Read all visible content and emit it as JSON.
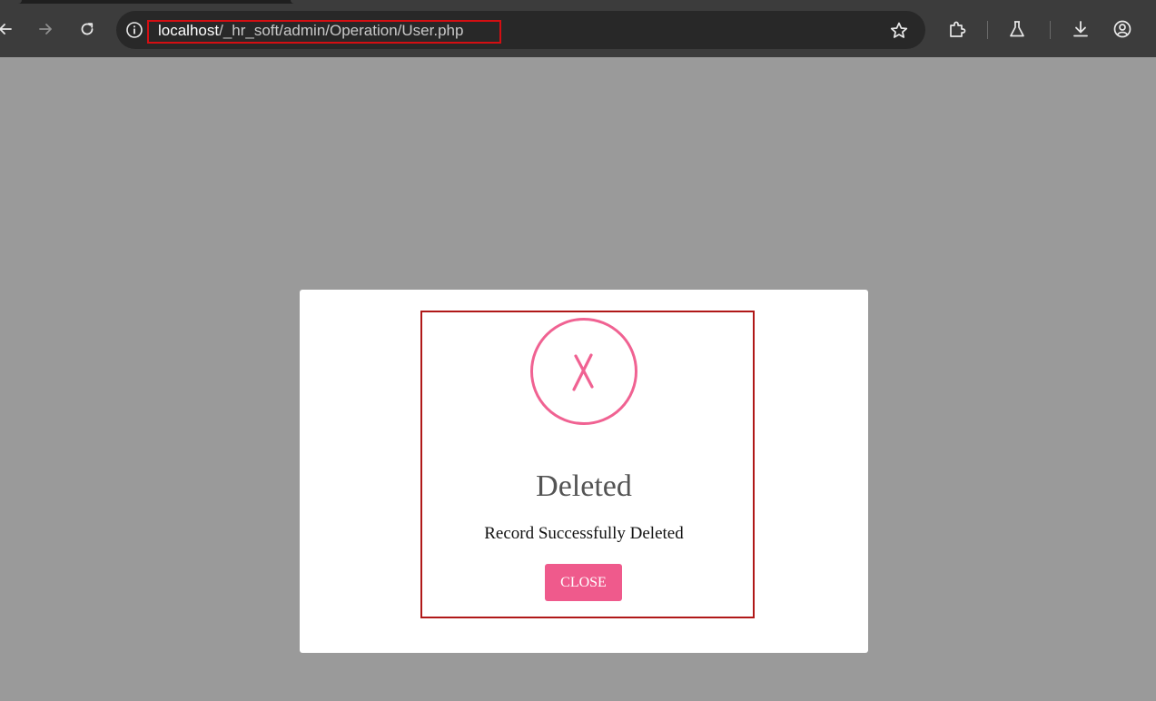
{
  "browser": {
    "url_host": "localhost",
    "url_path": "/_hr_soft/admin/Operation/User.php",
    "icons": {
      "back": "arrow-left-icon",
      "forward": "arrow-right-icon",
      "reload": "reload-icon",
      "site_info": "info-icon",
      "bookmark": "star-icon",
      "extensions": "puzzle-icon",
      "labs": "flask-icon",
      "downloads": "download-icon",
      "profile": "profile-icon"
    },
    "colors": {
      "toolbar": "#3c3c3c",
      "omnibox": "#282828",
      "url_highlight": "#d40e12"
    }
  },
  "modal": {
    "icon": "error-x-icon",
    "title": "Deleted",
    "message": "Record Successfully Deleted",
    "close_label": "CLOSE",
    "colors": {
      "accent": "#f06292",
      "button": "#ef5a8c",
      "overlay": "#9a9a9a",
      "highlight_border": "#b01818"
    }
  }
}
